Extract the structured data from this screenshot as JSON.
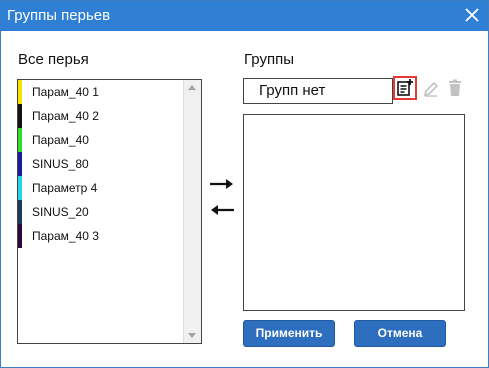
{
  "window": {
    "title": "Группы перьев"
  },
  "left": {
    "label": "Все перья",
    "items": [
      {
        "label": "Парам_40 1",
        "color": "#f5e300"
      },
      {
        "label": "Парам_40 2",
        "color": "#111111"
      },
      {
        "label": "Парам_40",
        "color": "#2ee02e"
      },
      {
        "label": "SINUS_80",
        "color": "#1a1aa0"
      },
      {
        "label": "Параметр 4",
        "color": "#22d6e8"
      },
      {
        "label": "SINUS_20",
        "color": "#1c3a5a"
      },
      {
        "label": "Парам_40 3",
        "color": "#2a0a3a"
      }
    ]
  },
  "right": {
    "label": "Группы",
    "select_value": "Групп нет"
  },
  "buttons": {
    "apply": "Применить",
    "cancel": "Отмена"
  },
  "colors": {
    "accent": "#2f7fd4",
    "button": "#2d6fbe",
    "highlight": "#e53935"
  }
}
